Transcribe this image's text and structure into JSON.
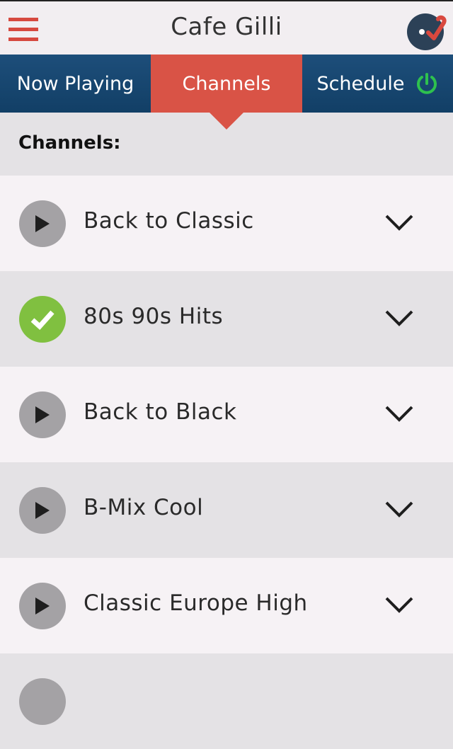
{
  "header": {
    "title": "Cafe Gilli",
    "menu_icon": "hamburger-menu-icon",
    "logo_icon": "disc-check-logo-icon"
  },
  "tabs": [
    {
      "label": "Now Playing",
      "active": false
    },
    {
      "label": "Channels",
      "active": true
    },
    {
      "label": "Schedule",
      "active": false,
      "icon": "power-icon"
    }
  ],
  "section": {
    "title": "Channels:"
  },
  "channels": [
    {
      "name": "Back to Classic",
      "state": "play"
    },
    {
      "name": "80s 90s Hits",
      "state": "selected"
    },
    {
      "name": "Back to Black",
      "state": "play"
    },
    {
      "name": "B-Mix Cool",
      "state": "play"
    },
    {
      "name": "Classic Europe High",
      "state": "play"
    },
    {
      "name": "",
      "state": "play"
    }
  ],
  "colors": {
    "accent_red": "#d95346",
    "tabbar_blue": "#1a4a72",
    "power_green": "#2ec14e",
    "selected_green": "#80c040",
    "play_gray": "#a4a2a5"
  }
}
